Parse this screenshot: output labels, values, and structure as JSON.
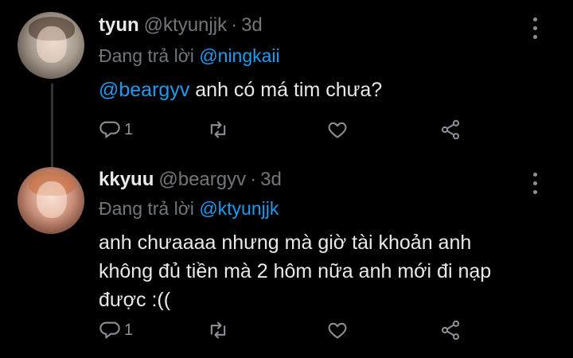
{
  "tweets": [
    {
      "name": "tyun",
      "handle": "@ktyunjjk",
      "time": "3d",
      "reply_prefix": "Đang trả lời",
      "reply_to": "@ningkaii",
      "mention": "@beargyv",
      "text": " anh có má tim chưa?",
      "reply_count": "1",
      "avatar_icon": "profile-photo"
    },
    {
      "name": "kkyuu",
      "handle": "@beargyv",
      "time": "3d",
      "reply_prefix": "Đang trả lời",
      "reply_to": "@ktyunjjk",
      "text_lines": [
        "anh chưaaaa nhưng mà giờ tài khoản anh",
        "không đủ tiền mà 2 hôm nữa anh mới đi nạp",
        "được :(("
      ],
      "reply_count": "1",
      "avatar_icon": "profile-photo"
    }
  ],
  "separator": "·",
  "colors": {
    "link": "#1d9bf0",
    "muted": "#71767b",
    "text": "#e7e9ea",
    "background": "#000000"
  }
}
